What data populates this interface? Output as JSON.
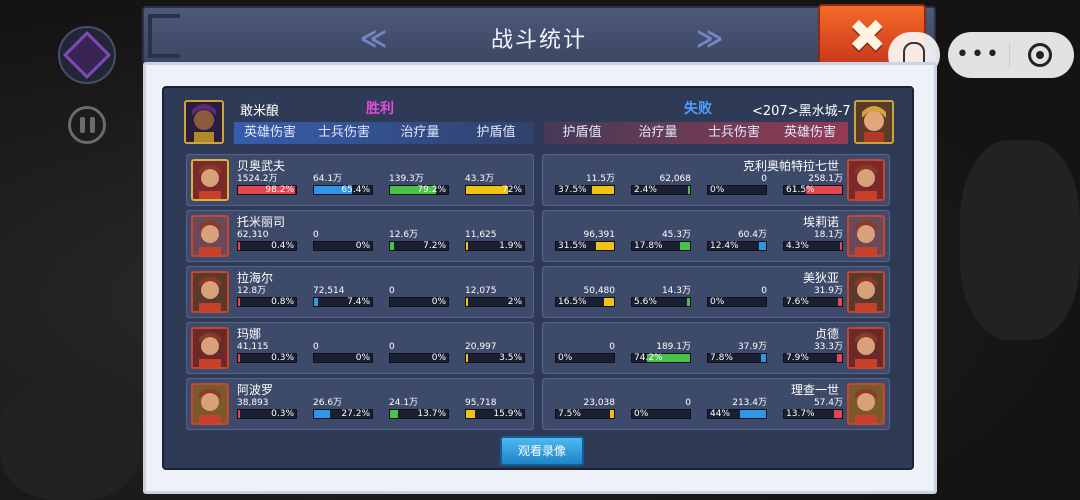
{
  "title": "战斗统计",
  "nav": {
    "prev": "≪",
    "next": "≫"
  },
  "close_label": "✖",
  "left": {
    "name": "敢米酿",
    "result": "胜利",
    "result_color": "#e24bd8"
  },
  "right": {
    "name": "<207>黑水城-7",
    "result": "失败",
    "result_color": "#4aa0ff"
  },
  "headers_left": [
    "英雄伤害",
    "士兵伤害",
    "治疗量",
    "护盾值"
  ],
  "headers_right": [
    "护盾值",
    "治疗量",
    "士兵伤害",
    "英雄伤害"
  ],
  "bar_colors": {
    "red": "#e0474f",
    "blue": "#2e97e6",
    "green": "#49c24a",
    "yellow": "#f0c313"
  },
  "rows_left": [
    {
      "name": "贝奥武夫",
      "level": "",
      "stats": [
        {
          "v": "1524.2万",
          "p": "98.2%",
          "pct": 98.2,
          "c": "red"
        },
        {
          "v": "64.1万",
          "p": "65.4%",
          "pct": 65.4,
          "c": "blue"
        },
        {
          "v": "139.3万",
          "p": "79.2%",
          "pct": 79.2,
          "c": "green"
        },
        {
          "v": "43.3万",
          "p": "72%",
          "pct": 72,
          "c": "yellow"
        }
      ]
    },
    {
      "name": "托米丽司",
      "level": "230",
      "stats": [
        {
          "v": "62,310",
          "p": "0.4%",
          "pct": 0.4,
          "c": "red"
        },
        {
          "v": "0",
          "p": "0%",
          "pct": 0,
          "c": "blue"
        },
        {
          "v": "12.6万",
          "p": "7.2%",
          "pct": 7.2,
          "c": "green"
        },
        {
          "v": "11,625",
          "p": "1.9%",
          "pct": 1.9,
          "c": "yellow"
        }
      ]
    },
    {
      "name": "拉海尔",
      "level": "230",
      "stats": [
        {
          "v": "12.8万",
          "p": "0.8%",
          "pct": 0.8,
          "c": "red"
        },
        {
          "v": "72,514",
          "p": "7.4%",
          "pct": 7.4,
          "c": "blue"
        },
        {
          "v": "0",
          "p": "0%",
          "pct": 0,
          "c": "green"
        },
        {
          "v": "12,075",
          "p": "2%",
          "pct": 2,
          "c": "yellow"
        }
      ]
    },
    {
      "name": "玛娜",
      "level": "230",
      "stats": [
        {
          "v": "41,115",
          "p": "0.3%",
          "pct": 0.3,
          "c": "red"
        },
        {
          "v": "0",
          "p": "0%",
          "pct": 0,
          "c": "blue"
        },
        {
          "v": "0",
          "p": "0%",
          "pct": 0,
          "c": "green"
        },
        {
          "v": "20,997",
          "p": "3.5%",
          "pct": 3.5,
          "c": "yellow"
        }
      ]
    },
    {
      "name": "阿波罗",
      "level": "230",
      "stats": [
        {
          "v": "38,893",
          "p": "0.3%",
          "pct": 0.3,
          "c": "red"
        },
        {
          "v": "26.6万",
          "p": "27.2%",
          "pct": 27.2,
          "c": "blue"
        },
        {
          "v": "24.1万",
          "p": "13.7%",
          "pct": 13.7,
          "c": "green"
        },
        {
          "v": "95,718",
          "p": "15.9%",
          "pct": 15.9,
          "c": "yellow"
        }
      ]
    }
  ],
  "rows_right": [
    {
      "name": "克利奥帕特拉七世",
      "level": "260",
      "stats": [
        {
          "v": "11.5万",
          "p": "37.5%",
          "pct": 37.5,
          "c": "yellow"
        },
        {
          "v": "62,068",
          "p": "2.4%",
          "pct": 2.4,
          "c": "green"
        },
        {
          "v": "0",
          "p": "0%",
          "pct": 0,
          "c": "blue"
        },
        {
          "v": "258.1万",
          "p": "61.5%",
          "pct": 61.5,
          "c": "red"
        }
      ]
    },
    {
      "name": "埃莉诺",
      "level": "260",
      "stats": [
        {
          "v": "96,391",
          "p": "31.5%",
          "pct": 31.5,
          "c": "yellow"
        },
        {
          "v": "45.3万",
          "p": "17.8%",
          "pct": 17.8,
          "c": "green"
        },
        {
          "v": "60.4万",
          "p": "12.4%",
          "pct": 12.4,
          "c": "blue"
        },
        {
          "v": "18.1万",
          "p": "4.3%",
          "pct": 4.3,
          "c": "red"
        }
      ]
    },
    {
      "name": "美狄亚",
      "level": "260",
      "stats": [
        {
          "v": "50,480",
          "p": "16.5%",
          "pct": 16.5,
          "c": "yellow"
        },
        {
          "v": "14.3万",
          "p": "5.6%",
          "pct": 5.6,
          "c": "green"
        },
        {
          "v": "0",
          "p": "0%",
          "pct": 0,
          "c": "blue"
        },
        {
          "v": "31.9万",
          "p": "7.6%",
          "pct": 7.6,
          "c": "red"
        }
      ]
    },
    {
      "name": "贞德",
      "level": "260",
      "stats": [
        {
          "v": "0",
          "p": "0%",
          "pct": 0,
          "c": "yellow"
        },
        {
          "v": "189.1万",
          "p": "74.2%",
          "pct": 74.2,
          "c": "green"
        },
        {
          "v": "37.9万",
          "p": "7.8%",
          "pct": 7.8,
          "c": "blue"
        },
        {
          "v": "33.3万",
          "p": "7.9%",
          "pct": 7.9,
          "c": "red"
        }
      ]
    },
    {
      "name": "理查一世",
      "level": "260",
      "stats": [
        {
          "v": "23,038",
          "p": "7.5%",
          "pct": 7.5,
          "c": "yellow"
        },
        {
          "v": "0",
          "p": "0%",
          "pct": 0,
          "c": "green"
        },
        {
          "v": "213.4万",
          "p": "44%",
          "pct": 44,
          "c": "blue"
        },
        {
          "v": "57.4万",
          "p": "13.7%",
          "pct": 13.7,
          "c": "red"
        }
      ]
    }
  ],
  "watch_replay": "观看录像"
}
